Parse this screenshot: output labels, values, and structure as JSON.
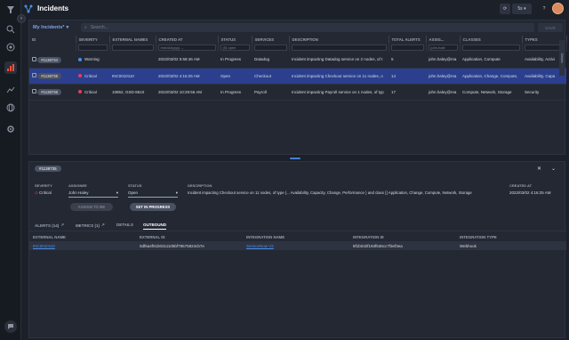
{
  "app": {
    "title": "Incidents"
  },
  "topbar": {
    "refresh_interval": "5s",
    "help_label": "?"
  },
  "toolbar": {
    "view_name": "My Incidents*",
    "search_placeholder": "Search...",
    "save_label": "SAVE"
  },
  "columns": [
    "ID",
    "SEVERITY",
    "EXTERNAL NAMES",
    "CREATED AT",
    "STATUS",
    "SERVICES",
    "DESCRIPTION",
    "TOTAL ALERTS",
    "ASSIG...",
    "CLASSES",
    "TYPES"
  ],
  "filters": {
    "created_at": "mm/dd/yyyy, --",
    "status": "(0) open",
    "assignee": "john.hale"
  },
  "rows": [
    {
      "id": "#1138734",
      "severity": "Warning",
      "severity_color": "#4a8fe8",
      "external": "",
      "created": "2022/03/02 5:58:46 AM",
      "status": "In Progress",
      "service": "Datadog",
      "description": "Incident impacting Datadog service on 2 nodes, of t",
      "alerts": "5",
      "assignee": "john.haley@ma",
      "classes": "Application, Compute",
      "types": "Availability, Activi"
    },
    {
      "id": "#1138735",
      "severity": "Critical",
      "severity_color": "#e0405a",
      "external": "INC0010110",
      "created": "2022/03/02 4:16:25 AM",
      "status": "Open",
      "service": "Checkout",
      "description": "Incident impacting Checkout service on 11 nodes, o",
      "alerts": "14",
      "assignee": "john.haley@ma",
      "classes": "Application, Change, Compute,",
      "types": "Availability, Capa"
    },
    {
      "id": "#1138736",
      "severity": "Critical",
      "severity_color": "#e0405a",
      "external": "10852, GSD-8610",
      "created": "2022/03/02 10:29:56 AM",
      "status": "In Progress",
      "service": "Payroll",
      "description": "Incident impacting Payroll service on 1 nodes, of typ",
      "alerts": "17",
      "assignee": "john.haley@ma",
      "classes": "Compute, Network, Storage",
      "types": "Security"
    }
  ],
  "scroll_tab": "Details",
  "detail": {
    "id": "#1138735",
    "severity_label": "SEVERITY",
    "severity": "Critical",
    "assignee_label": "ASSIGNEE",
    "assignee": "John Haley",
    "status_label": "STATUS",
    "status": "Open",
    "description_label": "DESCRIPTION",
    "description": "Incident impacting Checkout service on 11 nodes, of type {... Availability, Capacity, Change, Performance } and class {} Application, Change, Compute, Network, Storage",
    "created_label": "CREATED AT",
    "created": "2022/03/02 4:16:25 AM",
    "assign_btn": "ASSIGN TO ME",
    "progress_btn": "SET IN PROGRESS",
    "tabs": [
      "ALERTS (14)",
      "METRICS (1)",
      "DETAILS",
      "OUTBOUND"
    ],
    "outbound": {
      "headers": [
        "EXTERNAL NAME",
        "EXTERNAL ID",
        "INTEGRATION NAME",
        "INTEGRATION ID",
        "INTEGRATION TYPE"
      ],
      "row": {
        "name": "INC0010110",
        "id": "0df6a4f01b0311105bf78575824cb7e",
        "integration": "ServiceNow V2",
        "integration_id": "8f1b032f193f536cc7f3ef3ea",
        "type": "Webhook"
      }
    }
  },
  "colors": {
    "accent": "#2b3f8e",
    "critical": "#e0405a",
    "warning": "#4a8fe8",
    "link": "#4a8fe8"
  }
}
